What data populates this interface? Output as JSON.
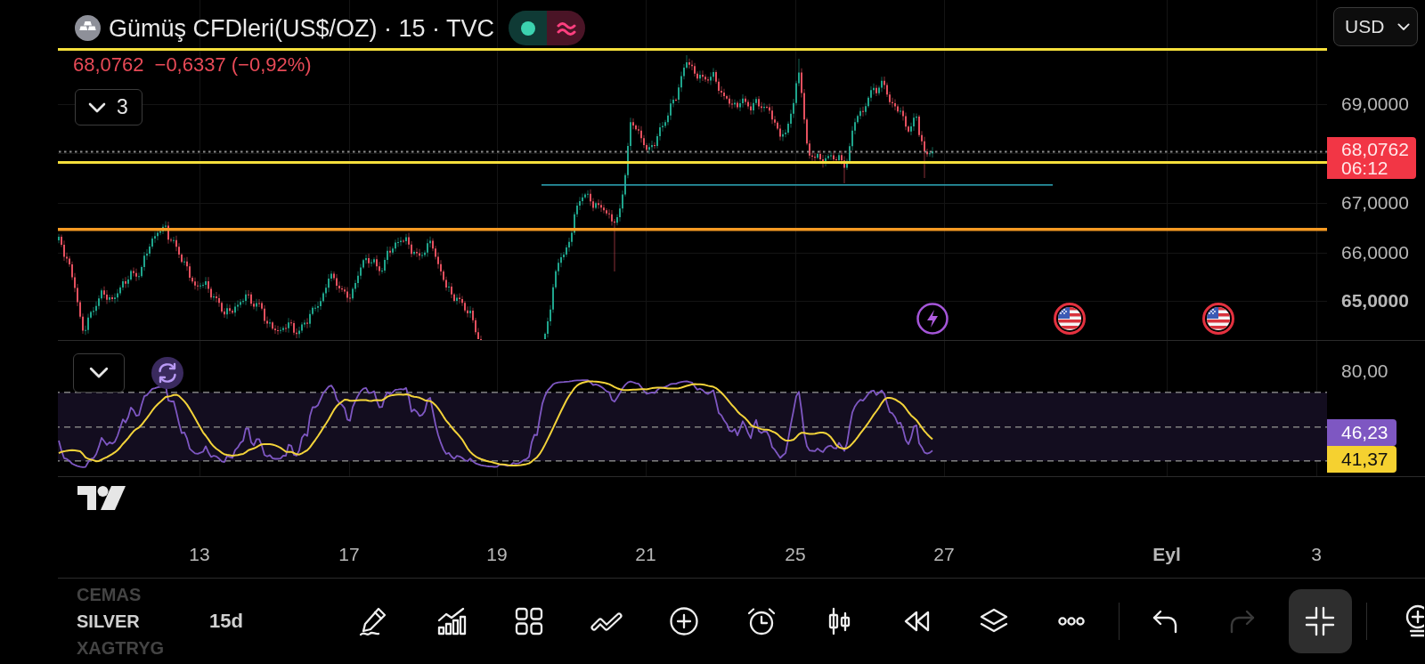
{
  "header": {
    "symbol": "Gümüş CFDleri(US$/OZ) · 15 · TVC",
    "price": "68,0762",
    "change": "−0,6337 (−0,92%)",
    "legend_toggle": {
      "label": "3"
    }
  },
  "chart": {
    "level_lines": [
      {
        "color": "#f5df3b"
      },
      {
        "color": "#f5df3b"
      },
      {
        "color": "#f59a23"
      },
      {
        "color": "#2b9fb0"
      }
    ]
  },
  "price_axis": {
    "currency": "USD",
    "labels": [
      {
        "text": "69,0000",
        "emphasized": false
      },
      {
        "text": "67,0000",
        "emphasized": false
      },
      {
        "text": "66,0000",
        "emphasized": false
      },
      {
        "text": "65,0000",
        "emphasized": true
      }
    ],
    "last_price": {
      "price": "68,0762",
      "countdown": "06:12"
    }
  },
  "rsi_axis": {
    "labels": [
      "80,00"
    ],
    "badges": [
      {
        "text": "46,23",
        "color": "#7e57c2"
      },
      {
        "text": "41,37",
        "color": "#f5d130"
      }
    ]
  },
  "time_axis": {
    "labels": [
      {
        "text": "13",
        "emphasized": false
      },
      {
        "text": "17",
        "emphasized": false
      },
      {
        "text": "19",
        "emphasized": false
      },
      {
        "text": "21",
        "emphasized": false
      },
      {
        "text": "25",
        "emphasized": false
      },
      {
        "text": "27",
        "emphasized": false
      },
      {
        "text": "Eyl",
        "emphasized": true
      },
      {
        "text": "3",
        "emphasized": false
      }
    ]
  },
  "toolbar": {
    "symbols": [
      {
        "label": "CEMAS",
        "selected": false
      },
      {
        "label": "SILVER",
        "selected": true
      },
      {
        "label": "XAGTRYG",
        "selected": false
      }
    ],
    "interval": "15d",
    "undo": {
      "disabled": false
    },
    "redo": {
      "disabled": true
    },
    "collapse": {
      "active": true
    }
  }
}
